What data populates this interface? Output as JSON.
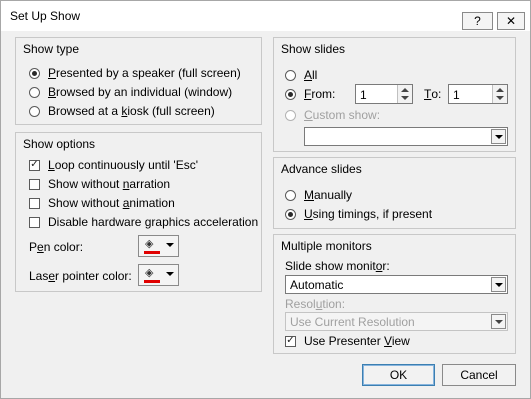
{
  "window": {
    "title": "Set Up Show",
    "help_label": "?",
    "close_label": "✕"
  },
  "show_type": {
    "title": "Show type",
    "options": [
      {
        "pre": "",
        "key": "P",
        "post": "resented by a speaker (full screen)",
        "checked": true
      },
      {
        "pre": "",
        "key": "B",
        "post": "rowsed by an individual (window)",
        "checked": false
      },
      {
        "pre": "Browsed at a ",
        "key": "k",
        "post": "iosk (full screen)",
        "checked": false
      }
    ]
  },
  "show_options": {
    "title": "Show options",
    "checkboxes": [
      {
        "pre": "",
        "key": "L",
        "post": "oop continuously until 'Esc'",
        "checked": true
      },
      {
        "pre": "Show without ",
        "key": "n",
        "post": "arration",
        "checked": false
      },
      {
        "pre": "Show without ",
        "key": "a",
        "post": "nimation",
        "checked": false
      },
      {
        "pre": "Disable hardware ",
        "key": "g",
        "post": "raphics acceleration",
        "checked": false
      }
    ],
    "pen_color": {
      "pre": "P",
      "key": "e",
      "post": "n color:",
      "color": "#e00000"
    },
    "laser_color": {
      "pre": "Las",
      "key": "e",
      "post": "r pointer color:",
      "color": "#e00000"
    }
  },
  "show_slides": {
    "title": "Show slides",
    "all": {
      "pre": "",
      "key": "A",
      "post": "ll",
      "checked": false
    },
    "from": {
      "pre": "",
      "key": "F",
      "post": "rom:",
      "checked": true,
      "value": "1"
    },
    "to": {
      "pre": "",
      "key": "T",
      "post": "o:",
      "value": "1"
    },
    "custom": {
      "pre": "",
      "key": "C",
      "post": "ustom show:",
      "value": ""
    }
  },
  "advance_slides": {
    "title": "Advance slides",
    "manually": {
      "pre": "",
      "key": "M",
      "post": "anually",
      "checked": false
    },
    "timings": {
      "pre": "",
      "key": "U",
      "post": "sing timings, if present",
      "checked": true
    }
  },
  "multiple_monitors": {
    "title": "Multiple monitors",
    "monitor_label": {
      "pre": "Slide show monit",
      "key": "o",
      "post": "r:"
    },
    "monitor_value": "Automatic",
    "resolution_label": {
      "pre": "Resol",
      "key": "u",
      "post": "tion:"
    },
    "resolution_value": "Use Current Resolution",
    "presenter": {
      "pre": "Use Presenter ",
      "key": "V",
      "post": "iew",
      "checked": true
    }
  },
  "buttons": {
    "ok": "OK",
    "cancel": "Cancel"
  }
}
